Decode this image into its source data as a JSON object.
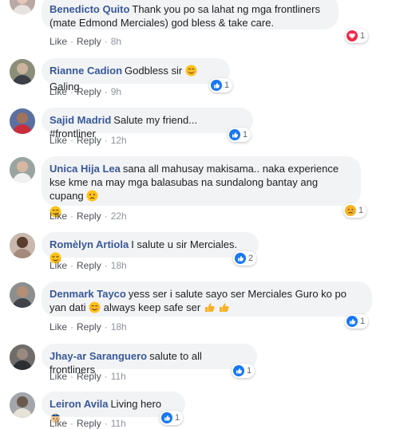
{
  "comments": [
    {
      "author": "Benedicto Quito",
      "text": "Thank you po sa lahat ng mga frontliners (mate Edmond Merciales) god bless & take care.",
      "emoji": "",
      "reaction": "heart",
      "reaction_count": "1",
      "like": "Like",
      "reply": "Reply",
      "time": "8h"
    },
    {
      "author": "Rianne Cadion",
      "text": "Godbless sir",
      "text2": "Galing",
      "emoji": "relieved",
      "reaction": "like",
      "reaction_count": "1",
      "like": "Like",
      "reply": "Reply",
      "time": "9h"
    },
    {
      "author": "Sajid Madrid",
      "text": "Salute my friend... #frontliner",
      "emoji": "",
      "reaction": "like",
      "reaction_count": "1",
      "like": "Like",
      "reply": "Reply",
      "time": "12h"
    },
    {
      "author": "Unica Hija Lea",
      "text": "sana all mahusay makisama.. naka experience kse kme na may mga balasubas na sundalong bantay ang cupang",
      "emoji": "worried",
      "emoji2": "smiling",
      "reaction": "sad",
      "reaction_count": "1",
      "like": "Like",
      "reply": "Reply",
      "time": "22h"
    },
    {
      "author": "Romèlyn Artiola",
      "text": "I salute u sir Merciales.",
      "emoji": "saluting",
      "reaction": "like",
      "reaction_count": "2",
      "like": "Like",
      "reply": "Reply",
      "time": "18h"
    },
    {
      "author": "Denmark Tayco",
      "text": "yess ser i salute sayo ser Merciales Guro ko po yan dati",
      "text2": "always keep safe ser",
      "emoji": "smiling",
      "emoji2": "thumbs-up",
      "reaction": "like",
      "reaction_count": "1",
      "like": "Like",
      "reply": "Reply",
      "time": "18h"
    },
    {
      "author": "Jhay-ar Saranguero",
      "text": "salute to all frontliners",
      "emoji": "",
      "reaction": "like",
      "reaction_count": "1",
      "like": "Like",
      "reply": "Reply",
      "time": "11h"
    },
    {
      "author": "Leiron Avila",
      "text": "Living hero",
      "emoji": "police",
      "reaction": "like",
      "reaction_count": "1",
      "like": "Like",
      "reply": "Reply",
      "time": "11h"
    }
  ],
  "colors": {
    "author": "#385898",
    "bubble": "#f2f3f5",
    "like_blue": "#1877f2",
    "heart_red": "#f0284a",
    "meta": "#606770"
  }
}
